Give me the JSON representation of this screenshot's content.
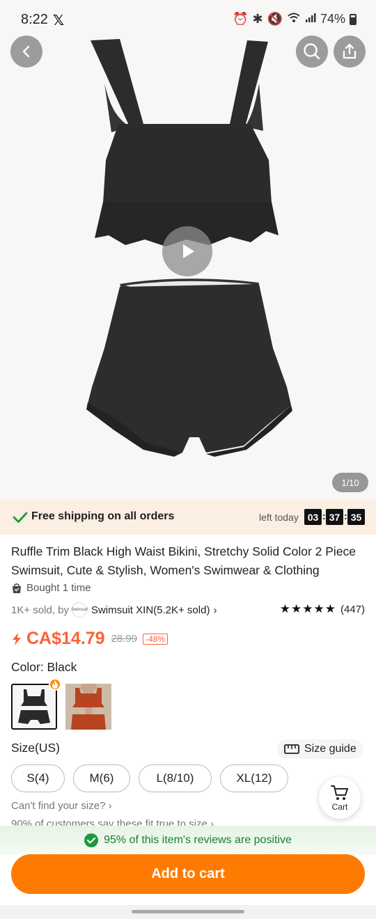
{
  "status_bar": {
    "time": "8:22",
    "x_app": "𝕏",
    "battery": "74%"
  },
  "hero": {
    "image_counter": "1/10",
    "icons": [
      "back-icon",
      "search-icon",
      "share-icon",
      "play-icon"
    ]
  },
  "shipping": {
    "text": "Free shipping on all orders",
    "left_today": "left today",
    "hours": "03",
    "minutes": "37",
    "seconds": "35"
  },
  "product": {
    "title": "Ruffle Trim Black High Waist Bikini, Stretchy Solid Color 2 Piece Swimsuit, Cute & Stylish, Women's Swimwear & Clothing",
    "bought": "Bought 1 time",
    "sold": "1K+ sold, by",
    "store_logo": "Swimsuit",
    "store": "Swimsuit XIN(5.2K+ sold)",
    "store_chevron": "›",
    "stars": "★★★★★",
    "review_count": "(447)",
    "rating_value": 4.8
  },
  "price": {
    "current": "CA$14.79",
    "original": "28.99",
    "discount": "-48%"
  },
  "color": {
    "label": "Color: Black",
    "options": [
      "Black",
      "Orange"
    ]
  },
  "size": {
    "label": "Size(US)",
    "guide": "Size guide",
    "options": [
      "S(4)",
      "M(6)",
      "L(8/10)",
      "XL(12)"
    ],
    "cant_find": "Can't find your size? ›",
    "fit_note": "90% of customers say these fit true to size ›"
  },
  "cart_float": {
    "label": "Cart"
  },
  "reviews": {
    "text": "95% of this item's reviews are positive"
  },
  "cta": {
    "add_to_cart": "Add to cart"
  },
  "colors": {
    "accent": "#ff7a00",
    "price": "#fa6338",
    "positive": "#1a7f2b",
    "shipping_bg": "#fbeee2"
  }
}
